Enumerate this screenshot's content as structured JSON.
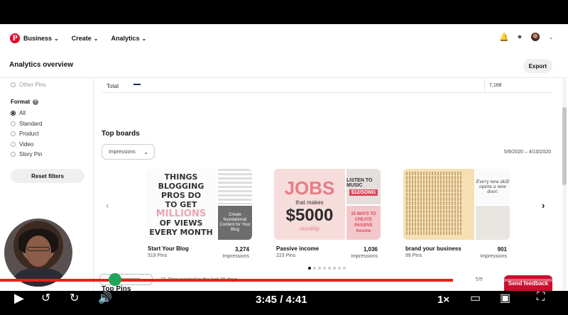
{
  "nav": {
    "business": "Business",
    "create": "Create",
    "analytics": "Analytics"
  },
  "header": {
    "title": "Analytics overview",
    "export": "Export"
  },
  "sidebar": {
    "other_pins": "Other Pins",
    "format_label": "Format",
    "options": [
      "All",
      "Standard",
      "Product",
      "Video",
      "Story Pin"
    ],
    "selected": "All",
    "reset": "Reset filters"
  },
  "total": {
    "label": "Total",
    "value": "7,168",
    "color": "#1a2a5e"
  },
  "top_boards": {
    "title": "Top boards",
    "metric": "Impressions",
    "date_range": "5/9/2020 – 4/10/2020",
    "boards": [
      {
        "name": "Start Your Blog",
        "pins": "519 Pins",
        "value": "3,274",
        "metric": "Impressions"
      },
      {
        "name": "Passive income",
        "pins": "223 Pins",
        "value": "1,036",
        "metric": "Impressions"
      },
      {
        "name": "brand your business",
        "pins": "99 Pins",
        "value": "901",
        "metric": "Impressions"
      }
    ]
  },
  "thumbs": {
    "a_lines": [
      "THINGS",
      "BLOGGING",
      "PROS DO",
      "TO GET",
      "MILLIONS",
      "OF VIEWS",
      "EVERY MONTH"
    ],
    "a_side": "Create foundational Content for Your Blog",
    "b_big": "JOBS",
    "b_small": "that makes",
    "b_money": "$5000",
    "b_month": "monthly",
    "b_side1": "LISTEN TO MUSIC",
    "b_tag": "$12/SONG",
    "b_side2": "15 WAYS TO CREATE PASSIVE Income",
    "c_side": "Every new skill opens a new door."
  },
  "top_pins": {
    "title": "Top Pins",
    "metric": "Impressions",
    "filter": "Pins created in the last 30 days",
    "date": "5/9"
  },
  "feedback": "Send feedback",
  "player": {
    "time": "3:45 / 4:41",
    "speed": "1×",
    "progress": 0.8
  }
}
